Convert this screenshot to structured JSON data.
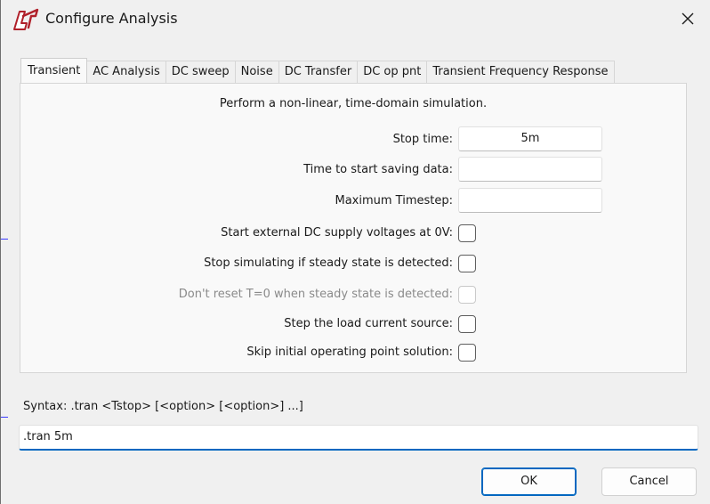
{
  "window": {
    "title": "Configure Analysis"
  },
  "tabs": [
    {
      "label": "Transient",
      "active": true
    },
    {
      "label": "AC Analysis",
      "active": false
    },
    {
      "label": "DC sweep",
      "active": false
    },
    {
      "label": "Noise",
      "active": false
    },
    {
      "label": "DC Transfer",
      "active": false
    },
    {
      "label": "DC op pnt",
      "active": false
    },
    {
      "label": "Transient Frequency Response",
      "active": false
    }
  ],
  "transient": {
    "description": "Perform a non-linear, time-domain simulation.",
    "stop_time": {
      "label": "Stop time:",
      "value": "5m"
    },
    "start_saving": {
      "label": "Time to start saving data:",
      "value": ""
    },
    "max_timestep": {
      "label": "Maximum Timestep:",
      "value": ""
    },
    "options": [
      {
        "label": "Start external DC supply voltages at 0V:",
        "checked": false,
        "enabled": true
      },
      {
        "label": "Stop simulating if steady state is detected:",
        "checked": false,
        "enabled": true
      },
      {
        "label": "Don't reset T=0 when steady state is detected:",
        "checked": false,
        "enabled": false
      },
      {
        "label": "Step the load current source:",
        "checked": false,
        "enabled": true
      },
      {
        "label": "Skip initial operating point solution:",
        "checked": false,
        "enabled": true
      }
    ]
  },
  "syntax": {
    "text": "Syntax:  .tran <Tstop> [<option> [<option>] ...]"
  },
  "command": {
    "value": ".tran 5m"
  },
  "buttons": {
    "ok": "OK",
    "cancel": "Cancel"
  },
  "icons": {
    "app": "ltspice-logo-icon",
    "close": "close-icon"
  },
  "colors": {
    "accent": "#0067c0",
    "background": "#f0f0f0",
    "panel": "#f9f9f9",
    "logo": "#b0202a"
  }
}
